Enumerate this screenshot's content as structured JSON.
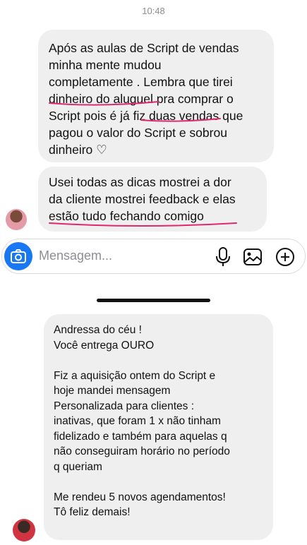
{
  "status": {
    "time": "10:48"
  },
  "messages_top": {
    "bubble1": [
      "Após as aulas de Script de vendas",
      "minha mente mudou",
      "completamente  . Lembra que tirei",
      "dinheiro do aluguel pra comprar o",
      "Script pois é já fiz duas vendas que",
      "pagou o valor do Script e sobrou",
      "dinheiro ♡"
    ],
    "bubble2": [
      "Usei todas as dicas mostrei a dor",
      "da cliente mostrei feedback e elas",
      "estão tudo fechando comigo"
    ]
  },
  "composer": {
    "placeholder": "Mensagem...",
    "icons": [
      "camera-icon",
      "microphone-icon",
      "image-icon",
      "plus-circle-icon"
    ],
    "accent": "#1877f2"
  },
  "highlight_color": "#e0286e",
  "messages_bottom": {
    "bubble3": [
      "Andressa do céu !",
      "Você entrega OURO",
      "",
      "Fiz a aquisição ontem do Script e",
      "hoje mandei mensagem",
      "Personalizada para clientes :",
      "inativas, que foram 1 x não tinham",
      "fidelizado e também para aquelas q",
      "não conseguiram horário no período",
      "q queriam",
      "",
      "Me rendeu 5 novos agendamentos!",
      "Tô feliz demais!"
    ]
  }
}
